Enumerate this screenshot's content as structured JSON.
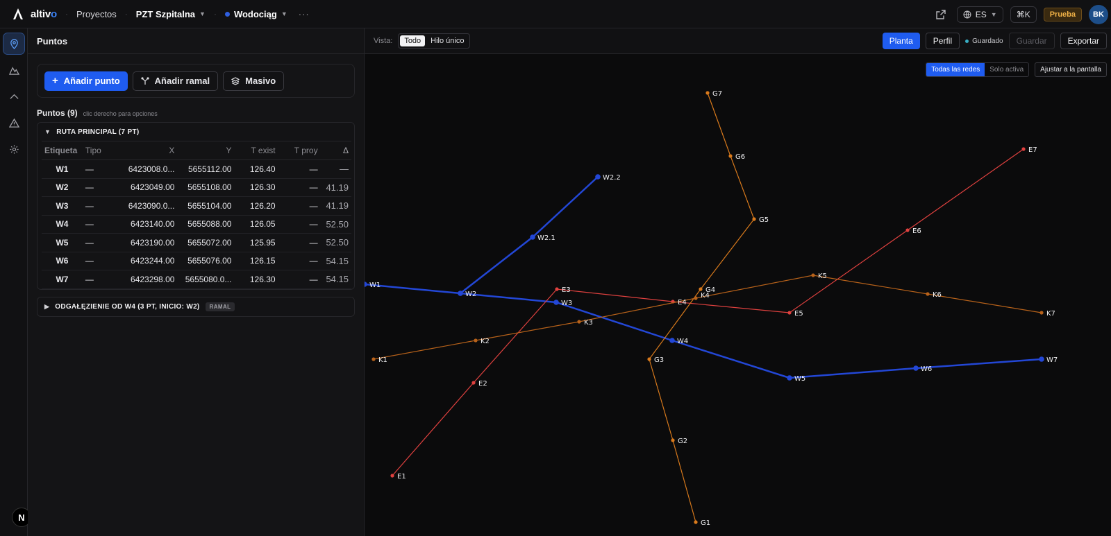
{
  "app": {
    "logo_text": "altiv",
    "logo_accent": "o"
  },
  "breadcrumb": {
    "projects": "Proyectos",
    "project": "PZT Szpitalna",
    "network": "Wodociąg",
    "more": "···"
  },
  "top_right": {
    "language": "ES",
    "shortcut": "⌘K",
    "plan_badge": "Prueba",
    "avatar": "BK"
  },
  "sidebar": {
    "title": "Puntos",
    "actions": {
      "add_point": "Añadir punto",
      "add_branch": "Añadir ramal",
      "bulk": "Masivo"
    },
    "points_title": "Puntos (9)",
    "points_hint": "clic derecho para opciones",
    "main_group": {
      "title": "RUTA PRINCIPAL (7 PT)",
      "columns": [
        "Etiqueta",
        "Tipo",
        "X",
        "Y",
        "T exist",
        "T proy",
        "Δ"
      ],
      "rows": [
        [
          "W1",
          "—",
          "6423008.0...",
          "5655112.00",
          "126.40",
          "—",
          "—"
        ],
        [
          "W2",
          "—",
          "6423049.00",
          "5655108.00",
          "126.30",
          "—",
          "41.19"
        ],
        [
          "W3",
          "—",
          "6423090.0...",
          "5655104.00",
          "126.20",
          "—",
          "41.19"
        ],
        [
          "W4",
          "—",
          "6423140.00",
          "5655088.00",
          "126.05",
          "—",
          "52.50"
        ],
        [
          "W5",
          "—",
          "6423190.00",
          "5655072.00",
          "125.95",
          "—",
          "52.50"
        ],
        [
          "W6",
          "—",
          "6423244.00",
          "5655076.00",
          "126.15",
          "—",
          "54.15"
        ],
        [
          "W7",
          "—",
          "6423298.00",
          "5655080.0...",
          "126.30",
          "—",
          "54.15"
        ]
      ]
    },
    "branch_group": {
      "title": "ODGAŁĘZIENIE OD W4 (3 PT, INICIO: W2)",
      "badge": "RAMAL"
    }
  },
  "toolbar": {
    "view_label": "Vista:",
    "view_options": [
      "Todo",
      "Hilo único"
    ],
    "view_selected": "Todo",
    "plan": "Planta",
    "profile": "Perfil",
    "saved": "Guardado",
    "save": "Guardar",
    "export": "Exportar"
  },
  "map_controls": {
    "all_networks": "Todas las redes",
    "active_only": "Solo activa",
    "fit": "Ajustar a la pantalla"
  },
  "colors": {
    "water": "#2347d6",
    "red": "#e0413f",
    "orange": "#d97a1c",
    "orange_dark": "#b8621a",
    "accent": "#1f5cf0"
  },
  "map": {
    "networks": [
      {
        "id": "W-main",
        "color": "#2347d6",
        "width": 2.5,
        "points": [
          "W1",
          "W2",
          "W3",
          "W4",
          "W5",
          "W6",
          "W7"
        ]
      },
      {
        "id": "W-branch",
        "color": "#2347d6",
        "width": 2.5,
        "points": [
          "W2",
          "W2.1",
          "W2.2"
        ]
      },
      {
        "id": "E",
        "color": "#e0413f",
        "width": 1.2,
        "points": [
          "E1",
          "E2",
          "E3",
          "E4",
          "E5",
          "E6",
          "E7"
        ]
      },
      {
        "id": "G",
        "color": "#d97a1c",
        "width": 1.2,
        "points": [
          "G1",
          "G2",
          "G3",
          "G4",
          "G5",
          "G6",
          "G7"
        ]
      },
      {
        "id": "K",
        "color": "#b8621a",
        "width": 1.2,
        "points": [
          "K1",
          "K2",
          "K3",
          "K4",
          "K5",
          "K6",
          "K7"
        ]
      }
    ],
    "labels": [
      "W1",
      "W2",
      "W3",
      "W4",
      "W5",
      "W6",
      "W7",
      "W2.1",
      "W2.2",
      "E1",
      "E2",
      "E3",
      "E4",
      "E5",
      "E6",
      "E7",
      "G1",
      "G2",
      "G3",
      "G4",
      "G5",
      "G6",
      "G7",
      "K1",
      "K2",
      "K3",
      "K4",
      "K5",
      "K6",
      "K7"
    ]
  }
}
